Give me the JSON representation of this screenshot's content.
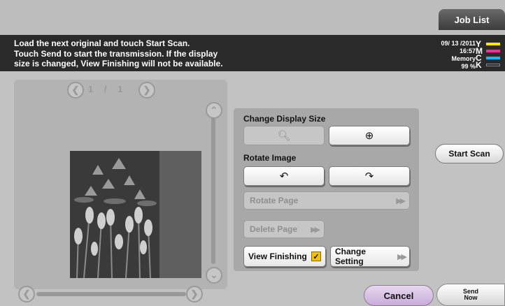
{
  "header": {
    "job_list_label": "Job List"
  },
  "message": {
    "line1": "Load the next original and touch Start Scan.",
    "line2": "Touch Send to start the transmission. If the display",
    "line3": "size is changed, View Finishing will not be available."
  },
  "status": {
    "date": "09/ 13 /2011",
    "time": "16:57",
    "memory_label": "Memory",
    "memory_value": "99 %",
    "toner": [
      {
        "letter": "Y",
        "color": "#ffe600"
      },
      {
        "letter": "M",
        "color": "#ff2a9a"
      },
      {
        "letter": "C",
        "color": "#18b6ff"
      },
      {
        "letter": "K",
        "color": "#2a2a2a"
      }
    ]
  },
  "preview": {
    "page_current": "1",
    "page_total": "1",
    "page_indicator": "1 / 1"
  },
  "panel": {
    "change_display_size_label": "Change Display Size",
    "rotate_image_label": "Rotate Image",
    "rotate_page_label": "Rotate Page",
    "delete_page_label": "Delete Page",
    "view_finishing_label": "View Finishing",
    "change_setting_label": "Change Setting"
  },
  "actions": {
    "start_scan_label": "Start Scan",
    "cancel_label": "Cancel",
    "send_label": "Send",
    "now_label": "Now"
  },
  "colors": {
    "message_bar": "#2a2a2a",
    "view_finishing_check": "#f2c200",
    "cancel_button": "#c8acd9"
  }
}
